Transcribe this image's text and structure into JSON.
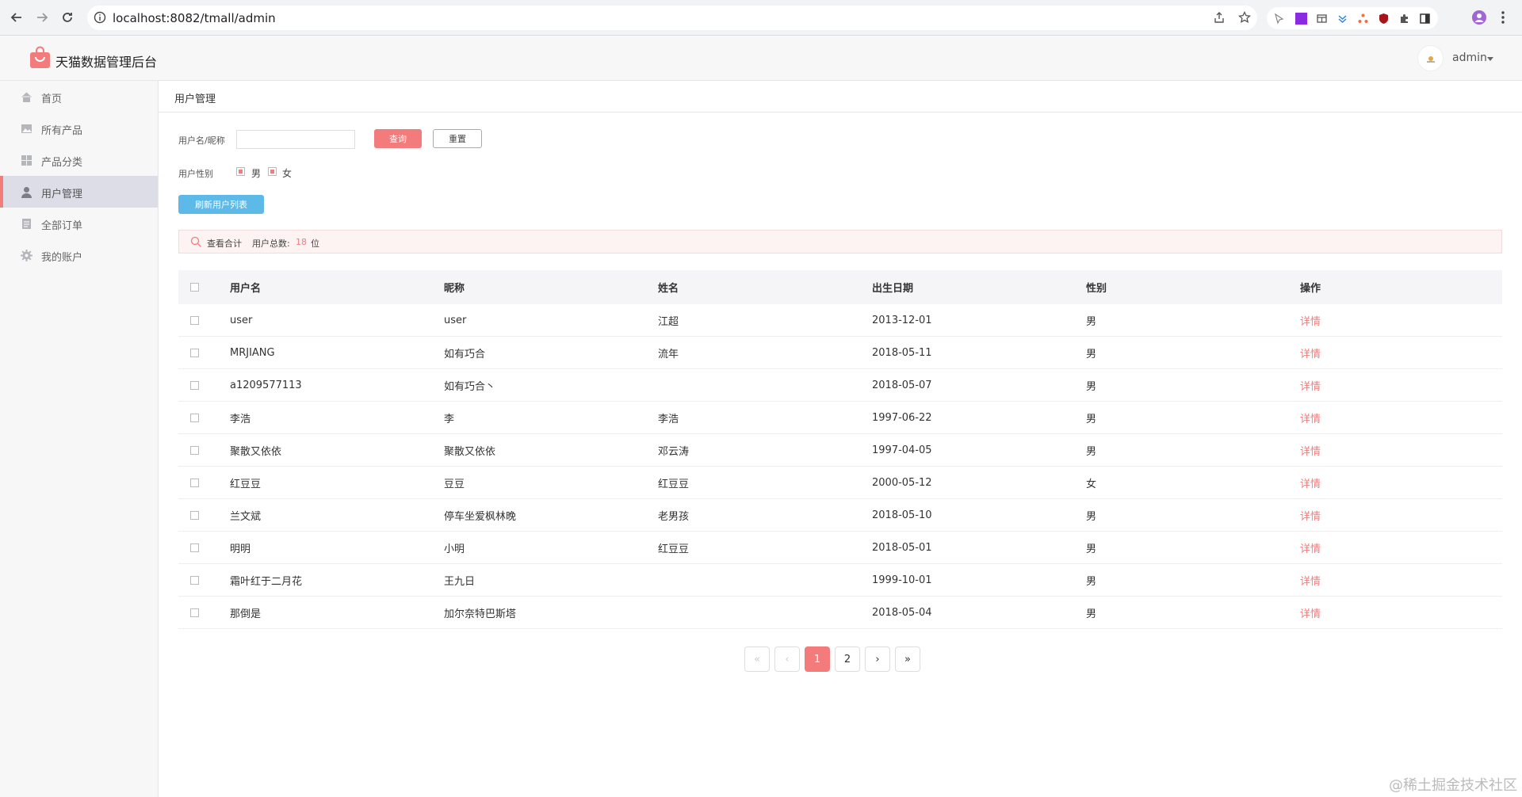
{
  "browser": {
    "url": "localhost:8082/tmall/admin"
  },
  "header": {
    "title": "天猫数据管理后台",
    "user": "admin"
  },
  "sidebar": {
    "items": [
      {
        "label": "首页"
      },
      {
        "label": "所有产品"
      },
      {
        "label": "产品分类"
      },
      {
        "label": "用户管理",
        "active": true
      },
      {
        "label": "全部订单"
      },
      {
        "label": "我的账户"
      }
    ]
  },
  "page": {
    "title": "用户管理"
  },
  "filters": {
    "name_label": "用户名/昵称",
    "name_value": "",
    "query_label": "查询",
    "reset_label": "重置",
    "sex_label": "用户性别",
    "sex_male": "男",
    "sex_female": "女",
    "refresh_label": "刷新用户列表"
  },
  "summary": {
    "view_total": "查看合计",
    "total_label": "用户总数:",
    "total_count": "18",
    "unit": "位"
  },
  "table": {
    "headers": [
      "用户名",
      "昵称",
      "姓名",
      "出生日期",
      "性别",
      "操作"
    ],
    "rows": [
      {
        "username": "user",
        "nickname": "user",
        "name": "江超",
        "birthday": "2013-12-01",
        "sex": "男",
        "action": "详情"
      },
      {
        "username": "MRJIANG",
        "nickname": "如有巧合",
        "name": "流年",
        "birthday": "2018-05-11",
        "sex": "男",
        "action": "详情"
      },
      {
        "username": "a1209577113",
        "nickname": "如有巧合丶",
        "name": "",
        "birthday": "2018-05-07",
        "sex": "男",
        "action": "详情"
      },
      {
        "username": "李浩",
        "nickname": "李",
        "name": "李浩",
        "birthday": "1997-06-22",
        "sex": "男",
        "action": "详情"
      },
      {
        "username": "聚散又依依",
        "nickname": "聚散又依依",
        "name": "邓云涛",
        "birthday": "1997-04-05",
        "sex": "男",
        "action": "详情"
      },
      {
        "username": "红豆豆",
        "nickname": "豆豆",
        "name": "红豆豆",
        "birthday": "2000-05-12",
        "sex": "女",
        "action": "详情"
      },
      {
        "username": "兰文斌",
        "nickname": "停车坐爱枫林晚",
        "name": "老男孩",
        "birthday": "2018-05-10",
        "sex": "男",
        "action": "详情"
      },
      {
        "username": "明明",
        "nickname": "小明",
        "name": "红豆豆",
        "birthday": "2018-05-01",
        "sex": "男",
        "action": "详情"
      },
      {
        "username": "霜叶红于二月花",
        "nickname": "王九日",
        "name": "",
        "birthday": "1999-10-01",
        "sex": "男",
        "action": "详情"
      },
      {
        "username": "那倒是",
        "nickname": "加尔奈特巴斯塔",
        "name": "",
        "birthday": "2018-05-04",
        "sex": "男",
        "action": "详情"
      }
    ]
  },
  "pagination": {
    "first": "«",
    "prev": "‹",
    "pages": [
      "1",
      "2"
    ],
    "current": "1",
    "next": "›",
    "last": "»"
  },
  "watermark": "@稀土掘金技术社区",
  "colors": {
    "accent": "#f47b7b",
    "refresh_button": "#5cb9e8",
    "sidebar_active": "#dcdde7"
  }
}
